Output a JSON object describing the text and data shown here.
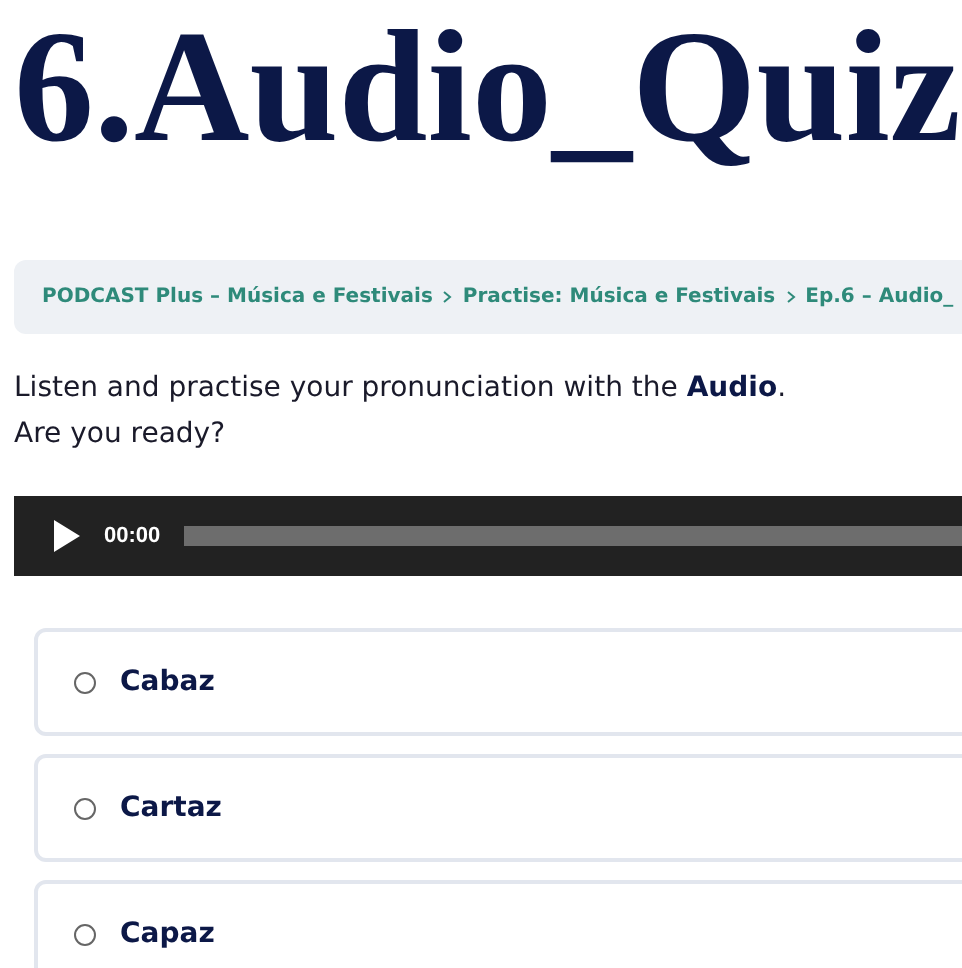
{
  "title": "6.Audio_Quiz",
  "breadcrumb": [
    "PODCAST Plus – Música e Festivais",
    "Practise: Música e Festivais",
    "Ep.6 – Audio_"
  ],
  "intro": [
    "Listen and practise your pronunciation with the **Audio**.",
    "Are you ready?"
  ],
  "player": {
    "time": "00:00",
    "level": 0
  },
  "options": [
    {
      "label": "Cabaz",
      "selected": false
    },
    {
      "label": "Cartaz",
      "selected": false
    },
    {
      "label": "Capaz",
      "selected": false
    }
  ]
}
